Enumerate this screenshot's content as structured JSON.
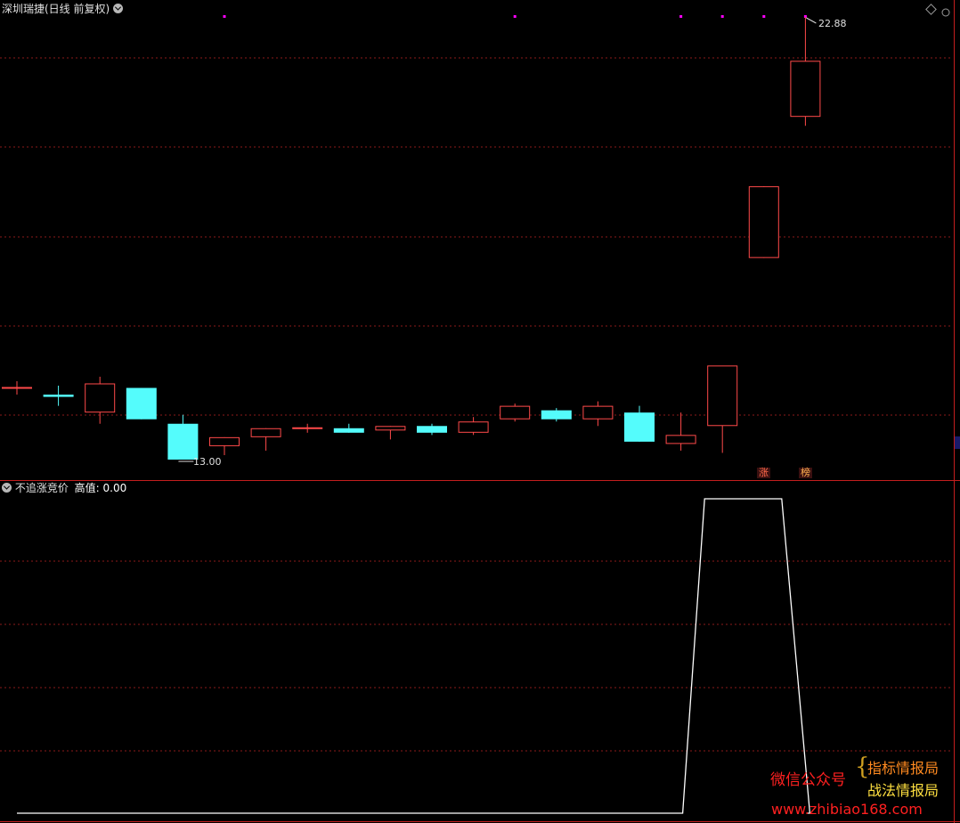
{
  "main_panel": {
    "title": "深圳瑞捷(日线 前复权)",
    "high_label": "22.88",
    "low_label": "13.00",
    "badges": [
      "涨",
      "榜"
    ]
  },
  "indicator_panel": {
    "name": "不追涨竞价",
    "series_label": "高值:",
    "series_value": "0.00"
  },
  "watermark": {
    "left": "微信公众号",
    "top_right": "指标情报局",
    "bottom_right": "战法情报局",
    "url": "www.zhibiao168.com"
  },
  "colors": {
    "background": "#000000",
    "up": "#ff4a4a",
    "down": "#54fcfc",
    "grid": "#8b1a1a",
    "border": "#c41e1e",
    "signal_dot": "#ff00ff",
    "indicator_line": "#ffffff"
  },
  "chart_data": [
    {
      "type": "candlestick",
      "title": "深圳瑞捷(日线 前复权)",
      "y_range": [
        12.6,
        23.4
      ],
      "candles": [
        {
          "open": 14.6,
          "high": 14.75,
          "low": 14.45,
          "close": 14.6
        },
        {
          "open": 14.45,
          "high": 14.65,
          "low": 14.2,
          "close": 14.4
        },
        {
          "open": 14.05,
          "high": 14.85,
          "low": 13.8,
          "close": 14.7
        },
        {
          "open": 14.6,
          "high": 14.6,
          "low": 13.9,
          "close": 13.9
        },
        {
          "open": 13.8,
          "high": 14.0,
          "low": 13.0,
          "close": 13.0
        },
        {
          "open": 13.3,
          "high": 13.5,
          "low": 13.1,
          "close": 13.5
        },
        {
          "open": 13.5,
          "high": 13.7,
          "low": 13.2,
          "close": 13.7
        },
        {
          "open": 13.7,
          "high": 13.8,
          "low": 13.6,
          "close": 13.7
        },
        {
          "open": 13.7,
          "high": 13.8,
          "low": 13.6,
          "close": 13.6
        },
        {
          "open": 13.65,
          "high": 13.75,
          "low": 13.45,
          "close": 13.75
        },
        {
          "open": 13.75,
          "high": 13.8,
          "low": 13.55,
          "close": 13.6
        },
        {
          "open": 13.6,
          "high": 13.95,
          "low": 13.55,
          "close": 13.85
        },
        {
          "open": 13.9,
          "high": 14.25,
          "low": 13.85,
          "close": 14.2
        },
        {
          "open": 14.1,
          "high": 14.15,
          "low": 13.85,
          "close": 13.9
        },
        {
          "open": 13.9,
          "high": 14.3,
          "low": 13.75,
          "close": 14.2
        },
        {
          "open": 14.05,
          "high": 14.2,
          "low": 13.4,
          "close": 13.4
        },
        {
          "open": 13.35,
          "high": 14.05,
          "low": 13.2,
          "close": 13.55
        },
        {
          "open": 13.75,
          "high": 14.05,
          "low": 13.15,
          "close": 15.1
        },
        {
          "open": 17.5,
          "high": 19.1,
          "low": 17.5,
          "close": 19.1
        },
        {
          "open": 20.65,
          "high": 22.88,
          "low": 20.45,
          "close": 21.9
        }
      ],
      "signal_markers_at_candle": [
        5,
        12,
        16,
        17,
        18,
        19
      ]
    },
    {
      "type": "line",
      "title": "不追涨竞价",
      "series": [
        {
          "name": "高值",
          "values": [
            0,
            0,
            0,
            0,
            0,
            0,
            0,
            0,
            0,
            0,
            0,
            0,
            0,
            0,
            0,
            0,
            0,
            1,
            1,
            0
          ]
        }
      ],
      "y_range": [
        0,
        1
      ]
    }
  ]
}
